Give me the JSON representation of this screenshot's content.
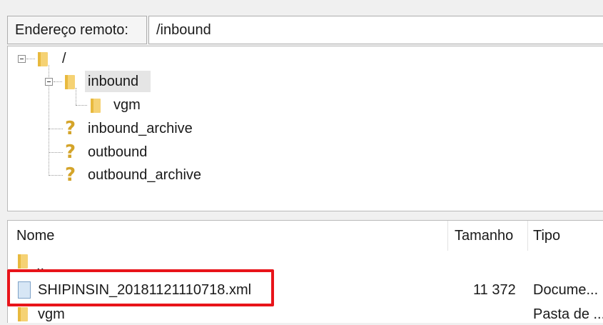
{
  "address": {
    "label": "Endereço remoto:",
    "value": "/inbound"
  },
  "tree": {
    "root": "/",
    "inbound": "inbound",
    "vgm": "vgm",
    "inbound_archive": "inbound_archive",
    "outbound": "outbound",
    "outbound_archive": "outbound_archive",
    "unknown_glyph": "?"
  },
  "list": {
    "columns": {
      "name": "Nome",
      "size": "Tamanho",
      "type": "Tipo"
    },
    "rows": [
      {
        "name": "..",
        "size": "",
        "type": ""
      },
      {
        "name": "SHIPINSIN_20181121110718.xml",
        "size": "11 372",
        "type": "Docume..."
      },
      {
        "name": "vgm",
        "size": "",
        "type": "Pasta de ..."
      }
    ]
  },
  "colors": {
    "folder": "#f5d274",
    "highlight": "#e8141a",
    "selected_row": "#e5e5e5"
  },
  "icons": {
    "folder": "folder-icon",
    "unknown": "question-mark-icon",
    "document": "document-icon",
    "collapse": "collapse-icon"
  }
}
